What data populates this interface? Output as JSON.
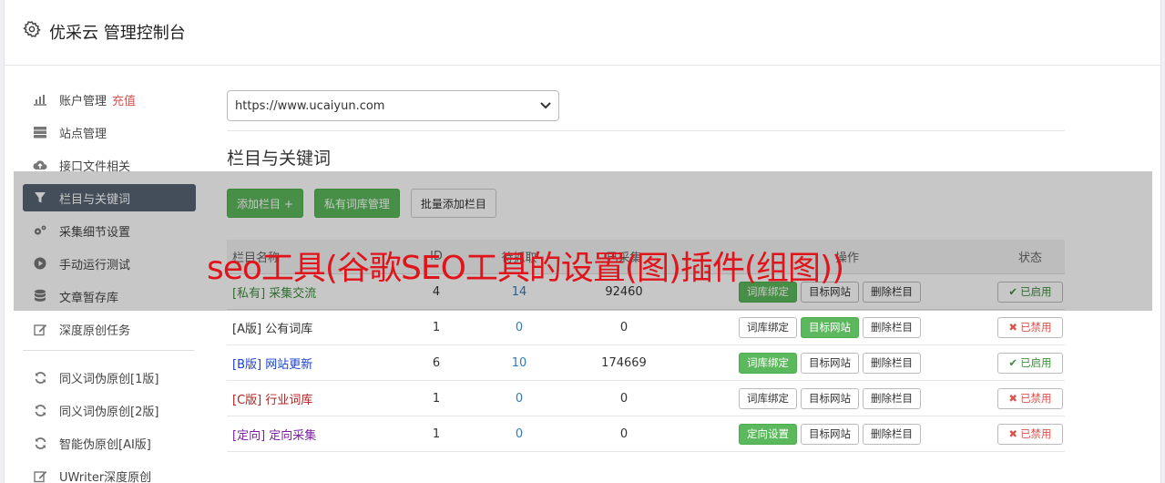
{
  "header": {
    "title": "优采云 管理控制台",
    "icon": "gear-icon"
  },
  "sidebar": {
    "items": [
      {
        "label": "账户管理",
        "extra": "充值",
        "icon": "bar-chart-icon"
      },
      {
        "label": "站点管理",
        "icon": "server-icon"
      },
      {
        "label": "接口文件相关",
        "icon": "cloud-upload-icon"
      },
      {
        "label": "栏目与关键词",
        "icon": "filter-icon",
        "active": true
      },
      {
        "label": "采集细节设置",
        "icon": "cogs-icon"
      },
      {
        "label": "手动运行测试",
        "icon": "play-circle-icon"
      },
      {
        "label": "文章暂存库",
        "icon": "database-icon"
      },
      {
        "label": "深度原创任务",
        "icon": "edit-icon"
      }
    ],
    "tools": [
      {
        "label": "同义词伪原创[1版]",
        "icon": "refresh-icon"
      },
      {
        "label": "同义词伪原创[2版]",
        "icon": "refresh-icon"
      },
      {
        "label": "智能伪原创[AI版]",
        "icon": "refresh-icon"
      },
      {
        "label": "UWriter深度原创",
        "icon": "edit-icon"
      }
    ]
  },
  "main": {
    "site_select": {
      "value": "https://www.ucaiyun.com"
    },
    "section_title": "栏目与关键词",
    "toolbar": {
      "add_column": "添加栏目 +",
      "private_lib": "私有词库管理",
      "batch_add": "批量添加栏目"
    },
    "table": {
      "headers": {
        "name": "栏目名称",
        "c1": "ID",
        "c2": "待抓取",
        "c3": "已采集",
        "ops": "操作",
        "status": "状态"
      },
      "rows": [
        {
          "tag": "[私有]",
          "name": "采集交流",
          "n1": "4",
          "n2": "14",
          "n3": "92460",
          "op1": "词库绑定",
          "op2": "目标网站",
          "op3": "删除栏目",
          "status": "已启用",
          "tag_color": "#3c8d3c"
        },
        {
          "tag": "[A版]",
          "name": "公有词库",
          "n1": "1",
          "n2": "0",
          "n3": "0",
          "op1": "词库绑定",
          "op2": "目标网站",
          "op3": "删除栏目",
          "status": "已禁用",
          "tag_color": "#333333"
        },
        {
          "tag": "[B版]",
          "name": "网站更新",
          "n1": "6",
          "n2": "10",
          "n3": "174669",
          "op1": "词库绑定",
          "op2": "目标网站",
          "op3": "删除栏目",
          "status": "已启用",
          "tag_color": "#1a3fd6"
        },
        {
          "tag": "[C版]",
          "name": "行业词库",
          "n1": "1",
          "n2": "0",
          "n3": "0",
          "op1": "词库绑定",
          "op2": "目标网站",
          "op3": "删除栏目",
          "status": "已禁用",
          "tag_color": "#b22222"
        },
        {
          "tag": "[定向]",
          "name": "定向采集",
          "n1": "1",
          "n2": "0",
          "n3": "0",
          "op1": "定向设置",
          "op2": "目标网站",
          "op3": "删除栏目",
          "status": "已禁用",
          "tag_color": "#7b1fa2"
        }
      ]
    }
  },
  "overlay": {
    "headline": "seo工具(谷歌SEO工具的设置(图)插件(组图))"
  },
  "colors": {
    "accent_green": "#5cb85c",
    "active_nav": "#576574",
    "headline_red": "#e0141b"
  }
}
